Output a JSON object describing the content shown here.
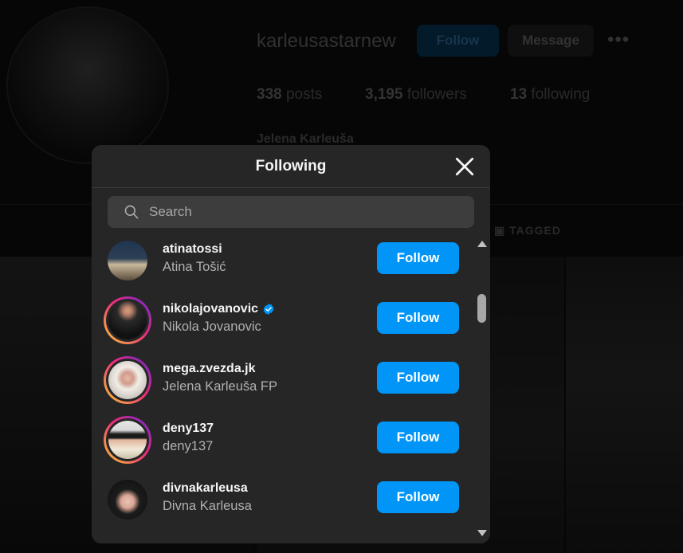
{
  "profile": {
    "username": "karleusastarnew",
    "follow_label": "Follow",
    "message_label": "Message",
    "more_label": "•••",
    "stats": {
      "posts_count": "338",
      "posts_label": "posts",
      "followers_count": "3,195",
      "followers_label": "followers",
      "following_count": "13",
      "following_label": "following"
    },
    "full_name": "Jelena Karleuša",
    "tagged_label": "TAGGED"
  },
  "modal": {
    "title": "Following",
    "search_placeholder": "Search",
    "users": [
      {
        "username": "atinatossi",
        "full_name": "Atina Tošić",
        "button": "Follow",
        "story": false,
        "verified": false
      },
      {
        "username": "nikolajovanovic",
        "full_name": "Nikola Jovanovic",
        "button": "Follow",
        "story": true,
        "verified": true
      },
      {
        "username": "mega.zvezda.jk",
        "full_name": "Jelena Karleuša FP",
        "button": "Follow",
        "story": true,
        "verified": false
      },
      {
        "username": "deny137",
        "full_name": "deny137",
        "button": "Follow",
        "story": true,
        "verified": false
      },
      {
        "username": "divnakarleusa",
        "full_name": "Divna Karleusa",
        "button": "Follow",
        "story": false,
        "verified": false
      }
    ]
  },
  "colors": {
    "accent": "#0095f6",
    "modal_bg": "#262626",
    "search_bg": "#3d3d3d",
    "verified": "#0095f6"
  }
}
